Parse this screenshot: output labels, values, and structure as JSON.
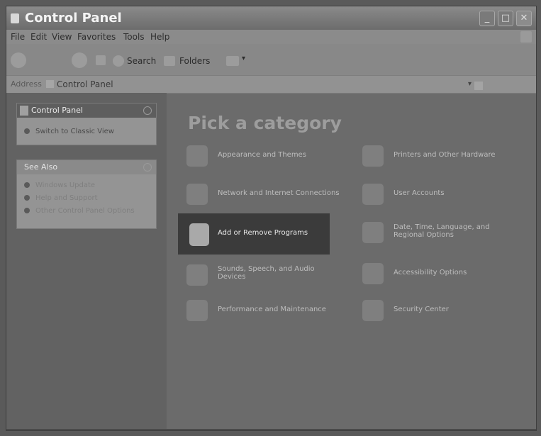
{
  "window": {
    "title": "Control Panel",
    "buttons": {
      "minimize": "_",
      "maximize": "□",
      "close": "✕"
    }
  },
  "menu": [
    "File",
    "Edit",
    "View",
    "Favorites",
    "Tools",
    "Help"
  ],
  "toolbar": {
    "search": "Search",
    "folders": "Folders"
  },
  "address": {
    "label": "Address",
    "value": "Control Panel"
  },
  "sidebar": {
    "control_panel": {
      "title": "Control Panel",
      "switch": "Switch to Classic View"
    },
    "see_also": {
      "title": "See Also",
      "items": [
        "Windows Update",
        "Help and Support",
        "Other Control Panel Options"
      ]
    }
  },
  "main": {
    "heading": "Pick a category",
    "left": [
      {
        "label": "Appearance and Themes",
        "icon": "appearance-icon"
      },
      {
        "label": "Network and Internet Connections",
        "icon": "network-icon"
      },
      {
        "label": "Add or Remove Programs",
        "icon": "add-remove-icon",
        "selected": true
      },
      {
        "label": "Sounds, Speech, and Audio Devices",
        "icon": "sound-icon"
      },
      {
        "label": "Performance and Maintenance",
        "icon": "performance-icon"
      }
    ],
    "right": [
      {
        "label": "Printers and Other Hardware",
        "icon": "printer-icon"
      },
      {
        "label": "User Accounts",
        "icon": "users-icon"
      },
      {
        "label": "Date, Time, Language, and Regional Options",
        "icon": "date-time-icon"
      },
      {
        "label": "Accessibility Options",
        "icon": "accessibility-icon"
      },
      {
        "label": "Security Center",
        "icon": "security-icon"
      }
    ]
  }
}
